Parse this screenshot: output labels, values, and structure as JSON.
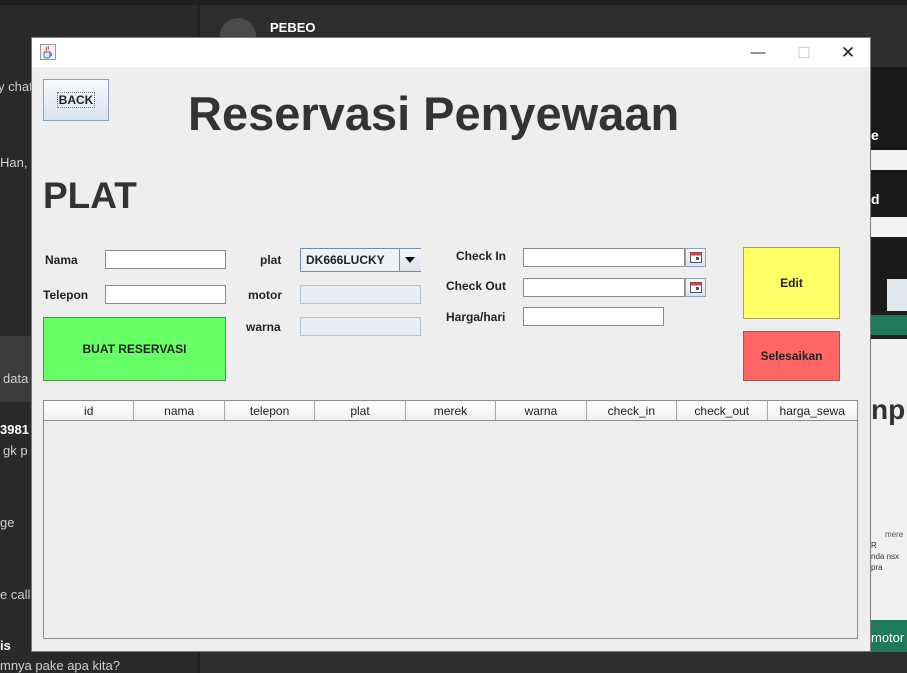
{
  "background_app": {
    "contact_name": "PEBEO",
    "chat_snippets": [
      "y chat",
      "Han, I",
      "data",
      "3981",
      "gk p",
      "ge",
      "e call",
      "is",
      "mnya pake apa kita?"
    ],
    "right_snippets": [
      "e",
      "d",
      "npu",
      "mere",
      "R",
      "nda nsx",
      "pra",
      "motor"
    ]
  },
  "window": {
    "title": "",
    "controls": {
      "minimize": "—",
      "maximize": "☐",
      "close": "✕"
    }
  },
  "form": {
    "back_label": "BACK",
    "title": "Reservasi Penyewaan",
    "plat_heading": "PLAT",
    "nama_label": "Nama",
    "nama_value": "",
    "telepon_label": "Telepon",
    "telepon_value": "",
    "plat_label": "plat",
    "plat_selected": "DK666LUCKY",
    "motor_label": "motor",
    "motor_value": "",
    "warna_label": "warna",
    "warna_value": "",
    "checkin_label": "Check In",
    "checkin_value": "",
    "checkout_label": "Check Out",
    "checkout_value": "",
    "harga_label": "Harga/hari",
    "harga_value": "",
    "buat_label": "BUAT RESERVASI",
    "edit_label": "Edit",
    "selesai_label": "Selesaikan"
  },
  "table": {
    "columns": [
      "id",
      "nama",
      "telepon",
      "plat",
      "merek",
      "warna",
      "check_in",
      "check_out",
      "harga_sewa"
    ],
    "rows": []
  },
  "colors": {
    "buat": "#66ff66",
    "edit": "#ffff66",
    "selesai": "#ff6666"
  }
}
